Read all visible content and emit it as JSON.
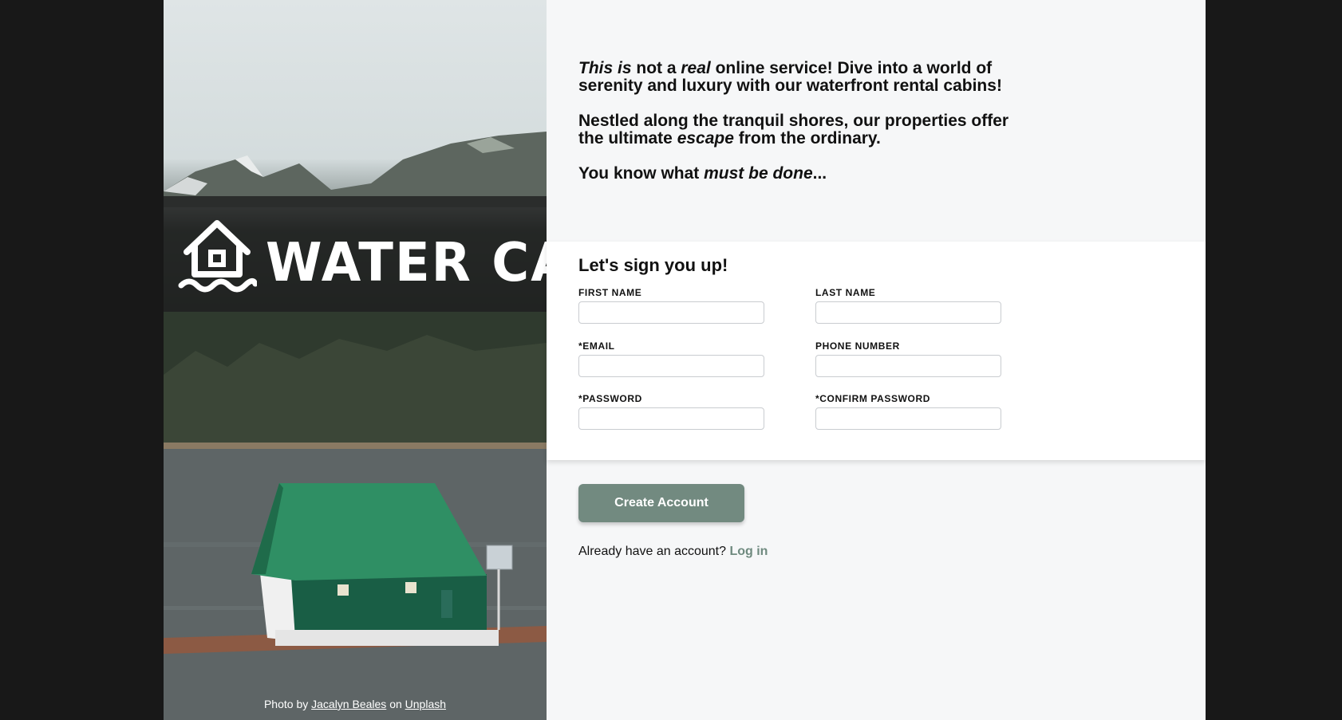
{
  "brand": {
    "name": "WATER CABIN",
    "logo_icon": "house-on-water-icon"
  },
  "photo_credit": {
    "prefix": "Photo by",
    "author": "Jacalyn Beales",
    "middle": "on",
    "site": "Unplash"
  },
  "intro": {
    "p1_a": "This is",
    "p1_b": " not a ",
    "p1_c": "real",
    "p1_d": " online service! Dive into a world of serenity and luxury with our waterfront rental cabins!",
    "p2_a": "Nestled along the tranquil shores, our properties offer the ultimate ",
    "p2_b": "escape",
    "p2_c": " from the ordinary.",
    "p3_a": "You know what ",
    "p3_b": "must be done",
    "p3_c": "..."
  },
  "form": {
    "title": "Let's sign you up!",
    "first_name_label": "FIRST NAME",
    "last_name_label": "LAST NAME",
    "email_label": "*EMAIL",
    "phone_label": "PHONE NUMBER",
    "password_label": "*PASSWORD",
    "confirm_password_label": "*CONFIRM PASSWORD",
    "first_name_value": "",
    "last_name_value": "",
    "email_value": "",
    "phone_value": "",
    "password_value": "",
    "confirm_password_value": ""
  },
  "actions": {
    "create_account": "Create Account",
    "login_prompt": "Already have an account?",
    "login_link": "Log in"
  },
  "colors": {
    "accent": "#728a80",
    "link": "#6f8a7f",
    "page_bg": "#181818",
    "panel_bg": "#f6f7f8"
  }
}
